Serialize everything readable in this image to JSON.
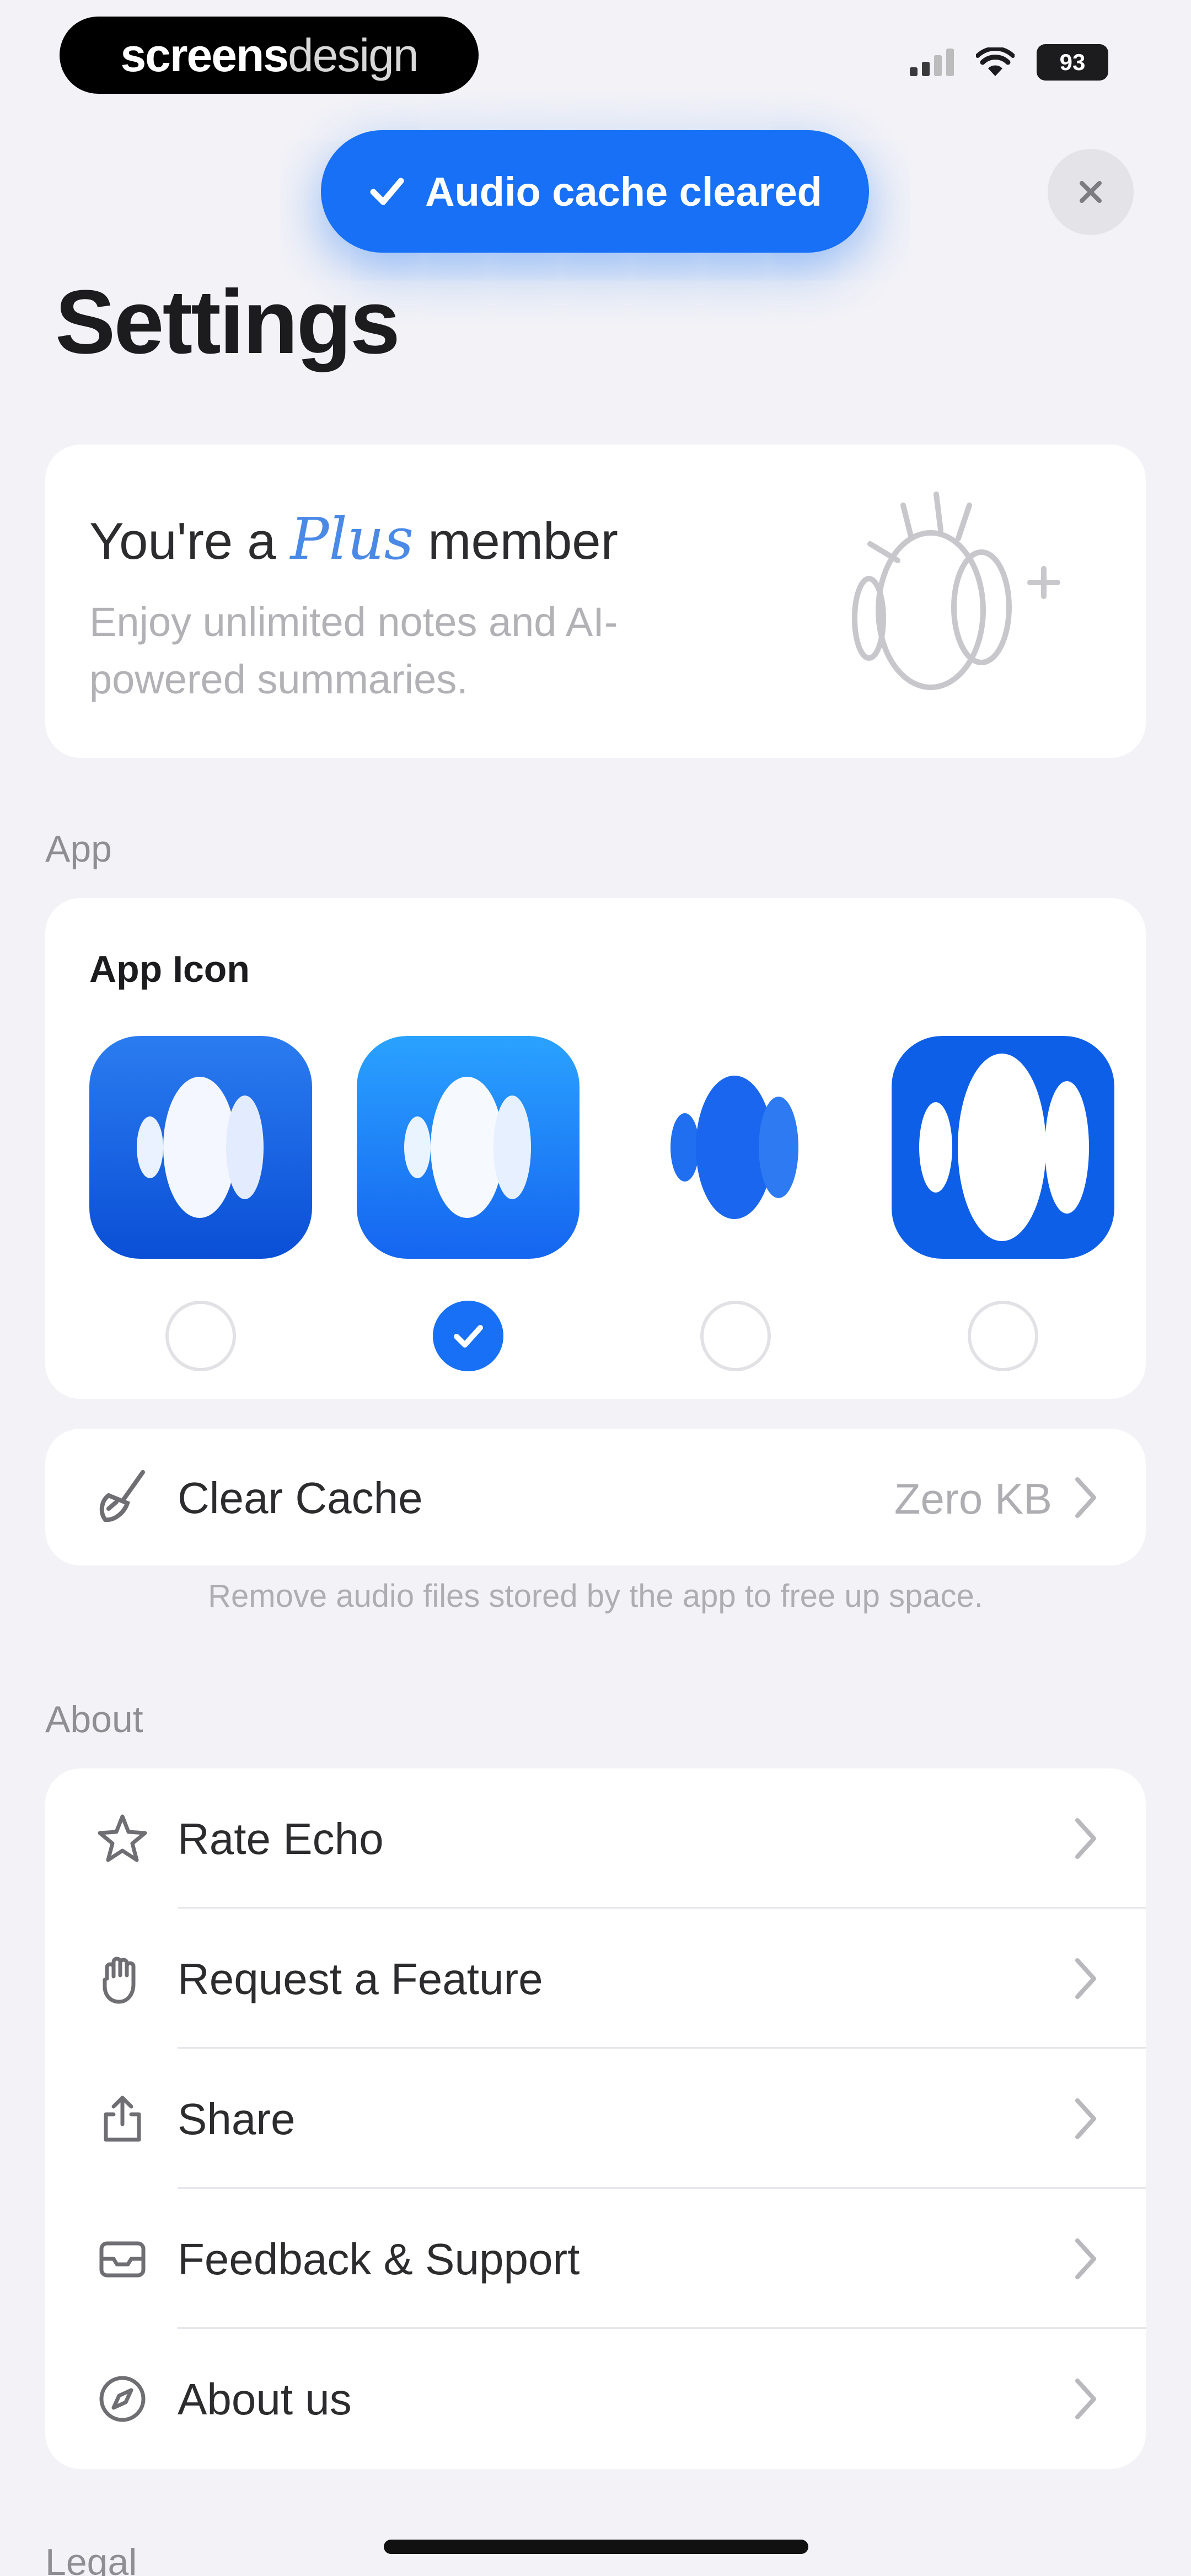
{
  "status_bar": {
    "brand_bold": "screens",
    "brand_light": "design",
    "battery": "93"
  },
  "toast": {
    "text": "Audio cache cleared",
    "icon": "checkmark-icon"
  },
  "header": {
    "title": "Settings",
    "close_icon": "close-icon"
  },
  "plus_card": {
    "title_prefix": "You're a",
    "title_plus": "Plus",
    "title_suffix": "member",
    "description": "Enjoy unlimited notes and AI-powered summaries."
  },
  "sections": {
    "app": "App",
    "about": "About",
    "legal": "Legal"
  },
  "app_icon": {
    "title": "App Icon",
    "options": [
      {
        "name": "dark-blue",
        "selected": false
      },
      {
        "name": "light-blue",
        "selected": true
      },
      {
        "name": "white",
        "selected": false
      },
      {
        "name": "bold-blue",
        "selected": false
      }
    ]
  },
  "cache": {
    "label": "Clear Cache",
    "value": "Zero KB",
    "note": "Remove audio files stored by the app to free up space."
  },
  "about_items": [
    {
      "label": "Rate Echo",
      "icon": "star-icon"
    },
    {
      "label": "Request a Feature",
      "icon": "hand-icon"
    },
    {
      "label": "Share",
      "icon": "share-icon"
    },
    {
      "label": "Feedback & Support",
      "icon": "mail-icon"
    },
    {
      "label": "About us",
      "icon": "compass-icon"
    }
  ],
  "colors": {
    "accent": "#1770f5",
    "background": "#f2f2f7",
    "card": "#ffffff"
  }
}
